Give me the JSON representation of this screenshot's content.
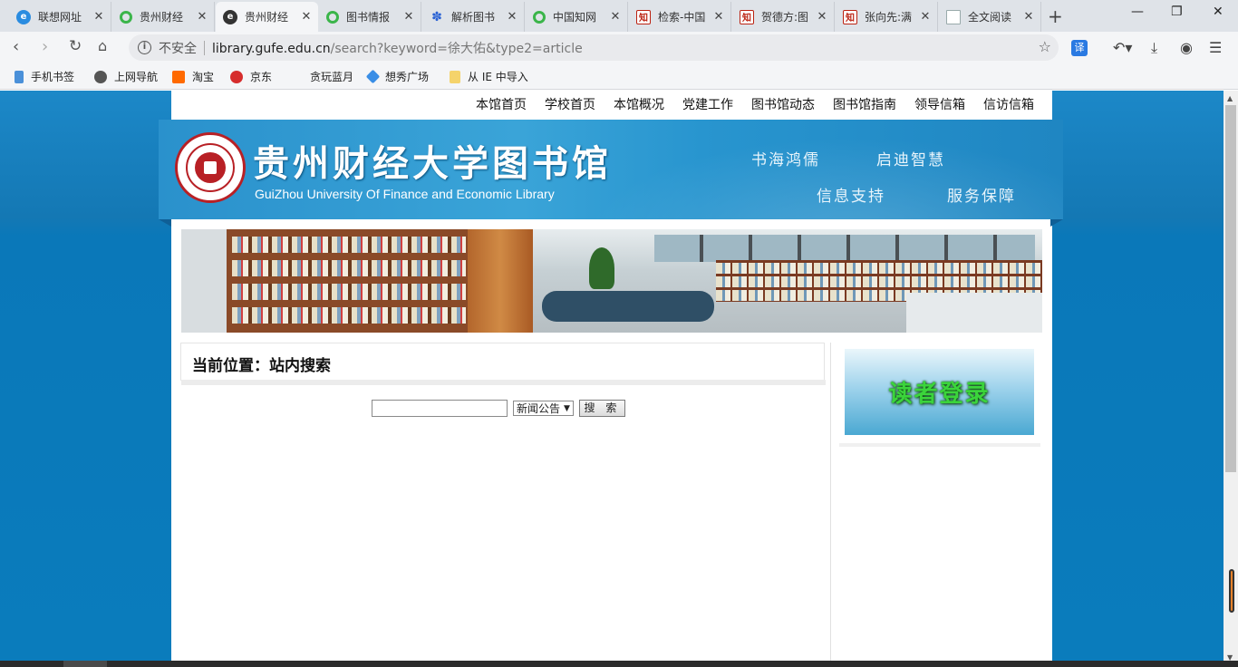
{
  "browser": {
    "tabs": [
      {
        "title": "联想网址",
        "icon": "e-browser-icon",
        "active": false
      },
      {
        "title": "贵州财经",
        "icon": "ring-icon",
        "active": false
      },
      {
        "title": "贵州财经",
        "icon": "e-dark-icon",
        "active": true
      },
      {
        "title": "图书情报",
        "icon": "ring-icon",
        "active": false
      },
      {
        "title": "解析图书",
        "icon": "paw-icon",
        "active": false
      },
      {
        "title": "中国知网",
        "icon": "ring-icon",
        "active": false
      },
      {
        "title": "检索-中国",
        "icon": "zhi-icon",
        "active": false
      },
      {
        "title": "贺德方:图",
        "icon": "zhi-icon",
        "active": false
      },
      {
        "title": "张向先:满",
        "icon": "zhi-icon",
        "active": false
      },
      {
        "title": "全文阅读",
        "icon": "doc-icon",
        "active": false
      }
    ],
    "security_label": "不安全",
    "url_host": "library.gufe.edu.cn",
    "url_rest": "/search?keyword=徐大佑&type2=article",
    "translate_label": "译",
    "bookmarks": [
      {
        "label": "手机书签",
        "color": "#4a90d9"
      },
      {
        "label": "上网导航",
        "color": "#555555"
      },
      {
        "label": "淘宝",
        "color": "#ff6a00"
      },
      {
        "label": "京东",
        "color": "#d62d2d"
      },
      {
        "label": "贪玩蓝月",
        "color": ""
      },
      {
        "label": "想秀广场",
        "color": "#3a8ee6"
      },
      {
        "label": "从 IE 中导入",
        "color": "#f5d36b"
      }
    ]
  },
  "site": {
    "nav": [
      "本馆首页",
      "学校首页",
      "本馆概况",
      "党建工作",
      "图书馆动态",
      "图书馆指南",
      "领导信箱",
      "信访信箱"
    ],
    "title": "贵州财经大学图书馆",
    "subtitle": "GuiZhou University Of Finance and Economic Library",
    "slogans": [
      "书海鸿儒",
      "启迪智慧",
      "信息支持",
      "服务保障"
    ],
    "breadcrumb": "当前位置：站内搜索",
    "search": {
      "input_value": "",
      "category": "新闻公告",
      "button_label": "搜 索"
    },
    "login_label": "读者登录",
    "colors": {
      "page_bg": "#0a7cbc",
      "banner": "#2a91cc",
      "login_text": "#3bd43b"
    }
  }
}
